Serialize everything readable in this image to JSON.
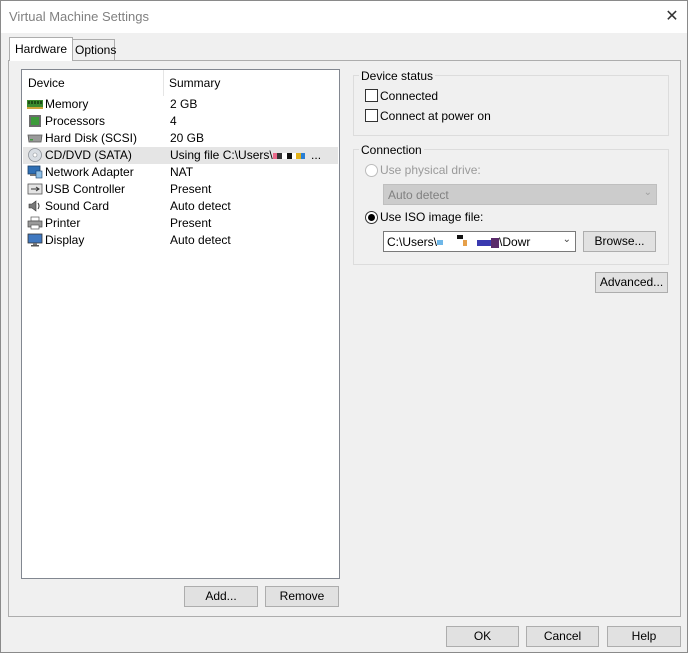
{
  "window": {
    "title": "Virtual Machine Settings",
    "close_glyph": "✕"
  },
  "tabs": [
    {
      "label": "Hardware"
    },
    {
      "label": "Options"
    }
  ],
  "device_list": {
    "col_device": "Device",
    "col_summary": "Summary",
    "rows": [
      {
        "name": "Memory",
        "summary": "2 GB",
        "icon": "memory-icon"
      },
      {
        "name": "Processors",
        "summary": "4",
        "icon": "processor-icon"
      },
      {
        "name": "Hard Disk (SCSI)",
        "summary": "20 GB",
        "icon": "hard-disk-icon"
      },
      {
        "name": "CD/DVD (SATA)",
        "summary": "Using file C:\\Users\\",
        "summary_tail": "...",
        "icon": "cd-dvd-icon"
      },
      {
        "name": "Network Adapter",
        "summary": "NAT",
        "icon": "network-adapter-icon"
      },
      {
        "name": "USB Controller",
        "summary": "Present",
        "icon": "usb-icon"
      },
      {
        "name": "Sound Card",
        "summary": "Auto detect",
        "icon": "sound-card-icon"
      },
      {
        "name": "Printer",
        "summary": "Present",
        "icon": "printer-icon"
      },
      {
        "name": "Display",
        "summary": "Auto detect",
        "icon": "display-icon"
      }
    ],
    "selected_index": 3
  },
  "buttons": {
    "add": "Add...",
    "remove": "Remove",
    "browse": "Browse...",
    "advanced": "Advanced...",
    "ok": "OK",
    "cancel": "Cancel",
    "help": "Help"
  },
  "device_status": {
    "title": "Device status",
    "connected": "Connected",
    "connect_at_power_on": "Connect at power on"
  },
  "connection": {
    "title": "Connection",
    "use_physical": "Use physical drive:",
    "physical_value": "Auto detect",
    "use_iso": "Use ISO image file:",
    "iso_path_start": "C:\\Users\\",
    "iso_path_end": "\\Dowr"
  }
}
